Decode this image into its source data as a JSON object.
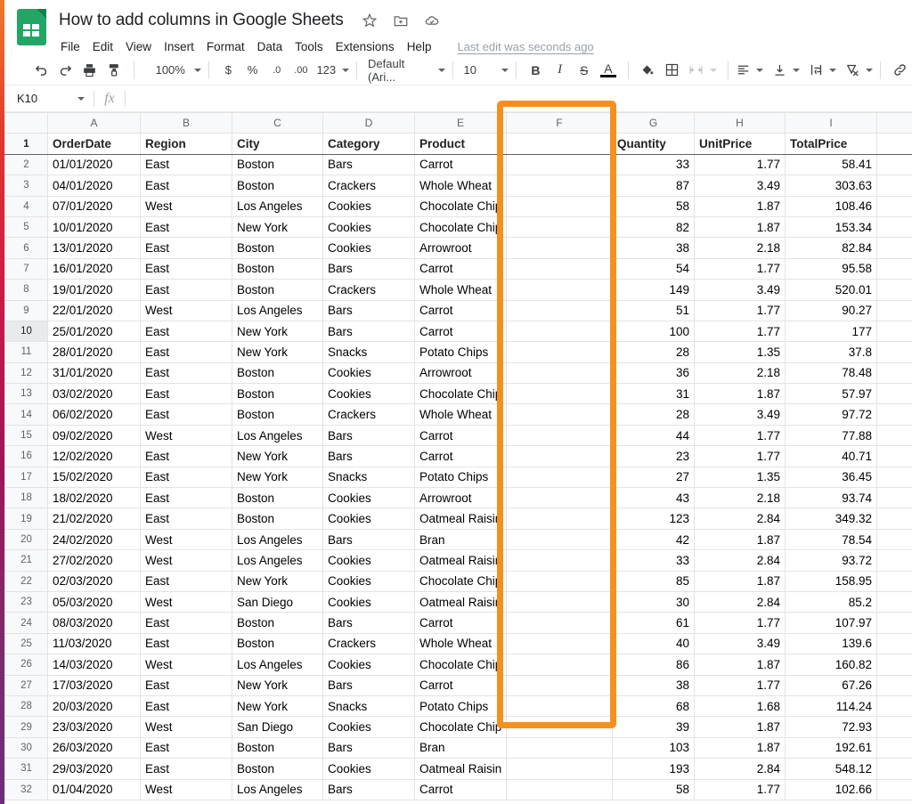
{
  "app": {
    "doc_title": "How to add columns in Google Sheets",
    "doc_icon": "sheets-logo-icon",
    "title_icons": [
      "star-icon",
      "move-to-folder-icon",
      "cloud-saved-icon"
    ],
    "menus": [
      "File",
      "Edit",
      "View",
      "Insert",
      "Format",
      "Data",
      "Tools",
      "Extensions",
      "Help"
    ],
    "last_edit": "Last edit was seconds ago"
  },
  "toolbar": {
    "undo": "undo-icon",
    "redo": "redo-icon",
    "print": "print-icon",
    "paint_format": "paint-format-icon",
    "zoom": "100%",
    "currency": "$",
    "percent": "%",
    "decrease_decimal": ".0",
    "increase_decimal": ".00",
    "more_formats": "123",
    "font": "Default (Ari...",
    "font_size": "10",
    "bold": "B",
    "italic": "I",
    "strikethrough": "S",
    "text_color": "A",
    "fill_color": "fill-color-icon",
    "borders": "borders-icon",
    "merge_cells": "merge-cells-icon",
    "horizontal_align": "horizontal-align-icon",
    "vertical_align": "vertical-align-icon",
    "text_wrap": "text-wrap-icon",
    "text_rotation": "text-rotation-icon",
    "insert_link": "insert-link-icon"
  },
  "formula_bar": {
    "name_box": "K10",
    "fx_label": "fx",
    "formula_value": ""
  },
  "grid": {
    "columns": [
      "A",
      "B",
      "C",
      "D",
      "E",
      "F",
      "G",
      "H",
      "I"
    ],
    "highlight": {
      "column": "F",
      "color": "#f5901f"
    },
    "selected_row_header": "10",
    "headers": [
      "OrderDate",
      "Region",
      "City",
      "Category",
      "Product",
      "",
      "Quantity",
      "UnitPrice",
      "TotalPrice"
    ],
    "rows": [
      [
        "01/01/2020",
        "East",
        "Boston",
        "Bars",
        "Carrot",
        "",
        "33",
        "1.77",
        "58.41"
      ],
      [
        "04/01/2020",
        "East",
        "Boston",
        "Crackers",
        "Whole Wheat",
        "",
        "87",
        "3.49",
        "303.63"
      ],
      [
        "07/01/2020",
        "West",
        "Los Angeles",
        "Cookies",
        "Chocolate Chip",
        "",
        "58",
        "1.87",
        "108.46"
      ],
      [
        "10/01/2020",
        "East",
        "New York",
        "Cookies",
        "Chocolate Chip",
        "",
        "82",
        "1.87",
        "153.34"
      ],
      [
        "13/01/2020",
        "East",
        "Boston",
        "Cookies",
        "Arrowroot",
        "",
        "38",
        "2.18",
        "82.84"
      ],
      [
        "16/01/2020",
        "East",
        "Boston",
        "Bars",
        "Carrot",
        "",
        "54",
        "1.77",
        "95.58"
      ],
      [
        "19/01/2020",
        "East",
        "Boston",
        "Crackers",
        "Whole Wheat",
        "",
        "149",
        "3.49",
        "520.01"
      ],
      [
        "22/01/2020",
        "West",
        "Los Angeles",
        "Bars",
        "Carrot",
        "",
        "51",
        "1.77",
        "90.27"
      ],
      [
        "25/01/2020",
        "East",
        "New York",
        "Bars",
        "Carrot",
        "",
        "100",
        "1.77",
        "177"
      ],
      [
        "28/01/2020",
        "East",
        "New York",
        "Snacks",
        "Potato Chips",
        "",
        "28",
        "1.35",
        "37.8"
      ],
      [
        "31/01/2020",
        "East",
        "Boston",
        "Cookies",
        "Arrowroot",
        "",
        "36",
        "2.18",
        "78.48"
      ],
      [
        "03/02/2020",
        "East",
        "Boston",
        "Cookies",
        "Chocolate Chip",
        "",
        "31",
        "1.87",
        "57.97"
      ],
      [
        "06/02/2020",
        "East",
        "Boston",
        "Crackers",
        "Whole Wheat",
        "",
        "28",
        "3.49",
        "97.72"
      ],
      [
        "09/02/2020",
        "West",
        "Los Angeles",
        "Bars",
        "Carrot",
        "",
        "44",
        "1.77",
        "77.88"
      ],
      [
        "12/02/2020",
        "East",
        "New York",
        "Bars",
        "Carrot",
        "",
        "23",
        "1.77",
        "40.71"
      ],
      [
        "15/02/2020",
        "East",
        "New York",
        "Snacks",
        "Potato Chips",
        "",
        "27",
        "1.35",
        "36.45"
      ],
      [
        "18/02/2020",
        "East",
        "Boston",
        "Cookies",
        "Arrowroot",
        "",
        "43",
        "2.18",
        "93.74"
      ],
      [
        "21/02/2020",
        "East",
        "Boston",
        "Cookies",
        "Oatmeal Raisin",
        "",
        "123",
        "2.84",
        "349.32"
      ],
      [
        "24/02/2020",
        "West",
        "Los Angeles",
        "Bars",
        "Bran",
        "",
        "42",
        "1.87",
        "78.54"
      ],
      [
        "27/02/2020",
        "West",
        "Los Angeles",
        "Cookies",
        "Oatmeal Raisin",
        "",
        "33",
        "2.84",
        "93.72"
      ],
      [
        "02/03/2020",
        "East",
        "New York",
        "Cookies",
        "Chocolate Chip",
        "",
        "85",
        "1.87",
        "158.95"
      ],
      [
        "05/03/2020",
        "West",
        "San Diego",
        "Cookies",
        "Oatmeal Raisin",
        "",
        "30",
        "2.84",
        "85.2"
      ],
      [
        "08/03/2020",
        "East",
        "Boston",
        "Bars",
        "Carrot",
        "",
        "61",
        "1.77",
        "107.97"
      ],
      [
        "11/03/2020",
        "East",
        "Boston",
        "Crackers",
        "Whole Wheat",
        "",
        "40",
        "3.49",
        "139.6"
      ],
      [
        "14/03/2020",
        "West",
        "Los Angeles",
        "Cookies",
        "Chocolate Chip",
        "",
        "86",
        "1.87",
        "160.82"
      ],
      [
        "17/03/2020",
        "East",
        "New York",
        "Bars",
        "Carrot",
        "",
        "38",
        "1.77",
        "67.26"
      ],
      [
        "20/03/2020",
        "East",
        "New York",
        "Snacks",
        "Potato Chips",
        "",
        "68",
        "1.68",
        "114.24"
      ],
      [
        "23/03/2020",
        "West",
        "San Diego",
        "Cookies",
        "Chocolate Chip",
        "",
        "39",
        "1.87",
        "72.93"
      ],
      [
        "26/03/2020",
        "East",
        "Boston",
        "Bars",
        "Bran",
        "",
        "103",
        "1.87",
        "192.61"
      ],
      [
        "29/03/2020",
        "East",
        "Boston",
        "Cookies",
        "Oatmeal Raisin",
        "",
        "193",
        "2.84",
        "548.12"
      ],
      [
        "01/04/2020",
        "West",
        "Los Angeles",
        "Bars",
        "Carrot",
        "",
        "58",
        "1.77",
        "102.66"
      ]
    ]
  }
}
